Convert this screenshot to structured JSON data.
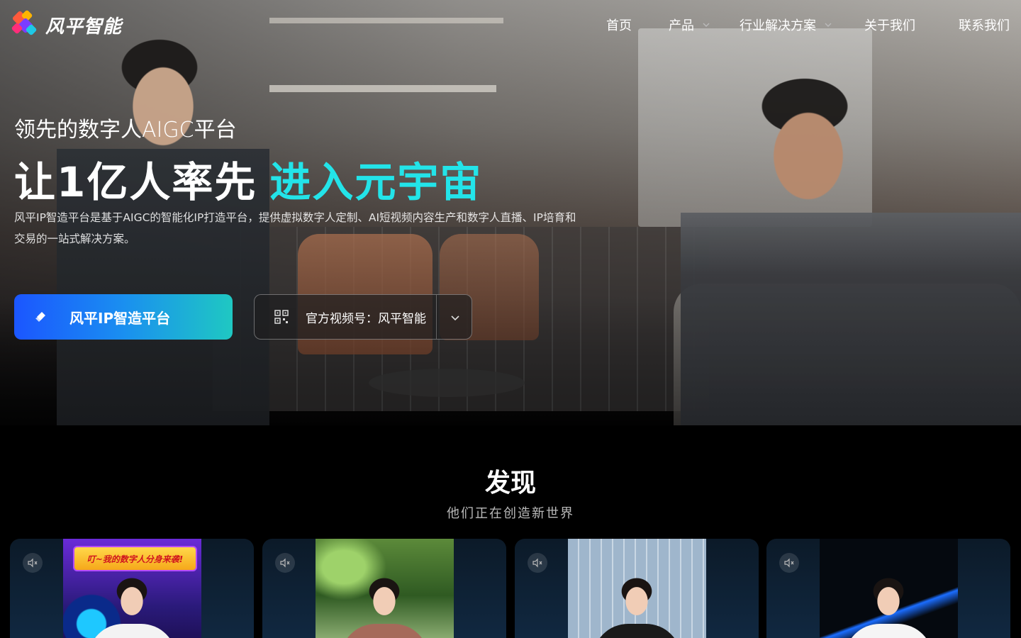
{
  "brand": {
    "name": "风平智能"
  },
  "nav": {
    "items": [
      {
        "label": "首页",
        "has_dropdown": false
      },
      {
        "label": "产品",
        "has_dropdown": true
      },
      {
        "label": "行业解决方案",
        "has_dropdown": true
      },
      {
        "label": "关于我们",
        "has_dropdown": false
      },
      {
        "label": "联系我们",
        "has_dropdown": false
      }
    ]
  },
  "hero": {
    "subtitle": "领先的数字人AIGC平台",
    "headline_main": "让1亿人率先",
    "headline_accent": "进入元宇宙",
    "description": "风平IP智造平台是基于AIGC的智能化IP打造平台，提供虚拟数字人定制、AI短视频内容生产和数字人直播、IP培育和交易的一站式解决方案。",
    "primary_button": "风平IP智造平台",
    "secondary_button": "官方视频号：风平智能",
    "accent_color": "#23e4e9"
  },
  "discover": {
    "title": "发现",
    "subtitle": "他们正在创造新世界",
    "cards": [
      {
        "banner": "叮~我的数字人分身来袭!",
        "muted": true
      },
      {
        "muted": true
      },
      {
        "muted": true
      },
      {
        "muted": true
      }
    ]
  }
}
